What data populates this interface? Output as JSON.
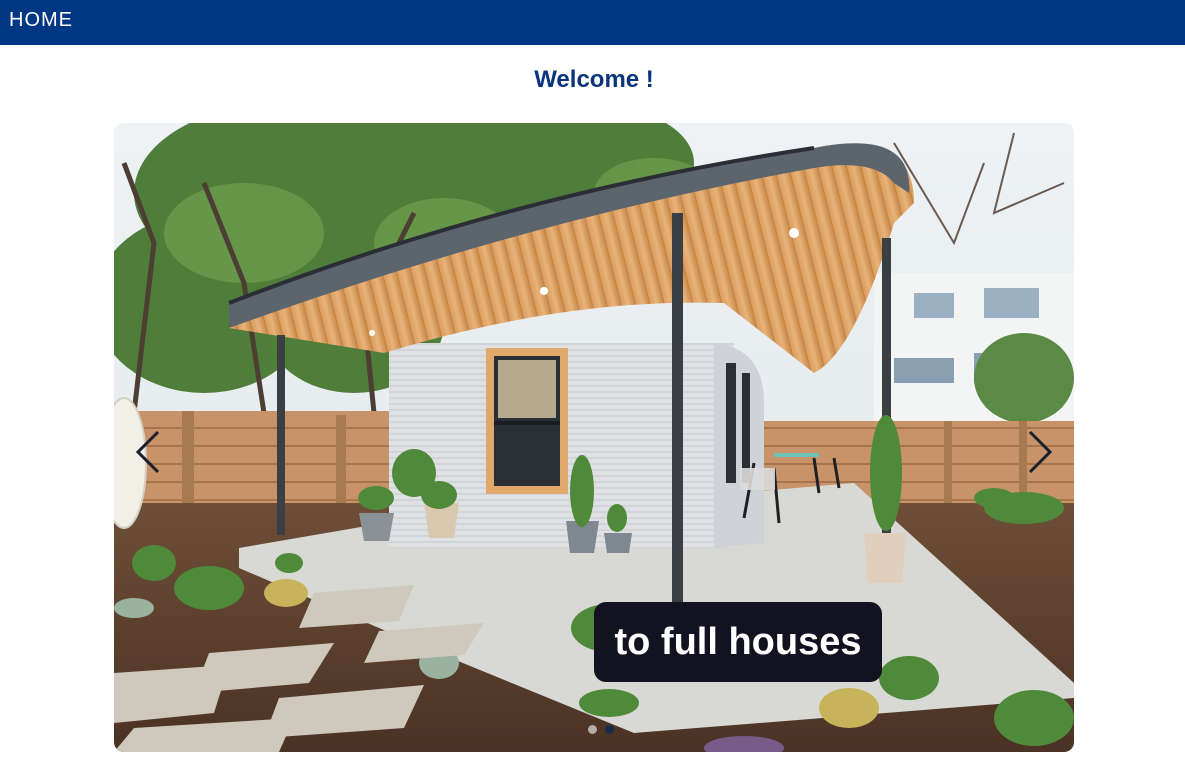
{
  "nav": {
    "home_label": "HOME"
  },
  "page": {
    "heading": "Welcome !"
  },
  "carousel": {
    "caption": "to full houses",
    "slide_count": 2,
    "active_slide": 2,
    "image_subject": "3D printed tiny house with wooden roof overhang and garden"
  },
  "colors": {
    "navbar": "#003785",
    "heading": "#0a347c",
    "caption_bg": "#121220"
  },
  "icons": {
    "prev": "chevron-left-icon",
    "next": "chevron-right-icon"
  }
}
